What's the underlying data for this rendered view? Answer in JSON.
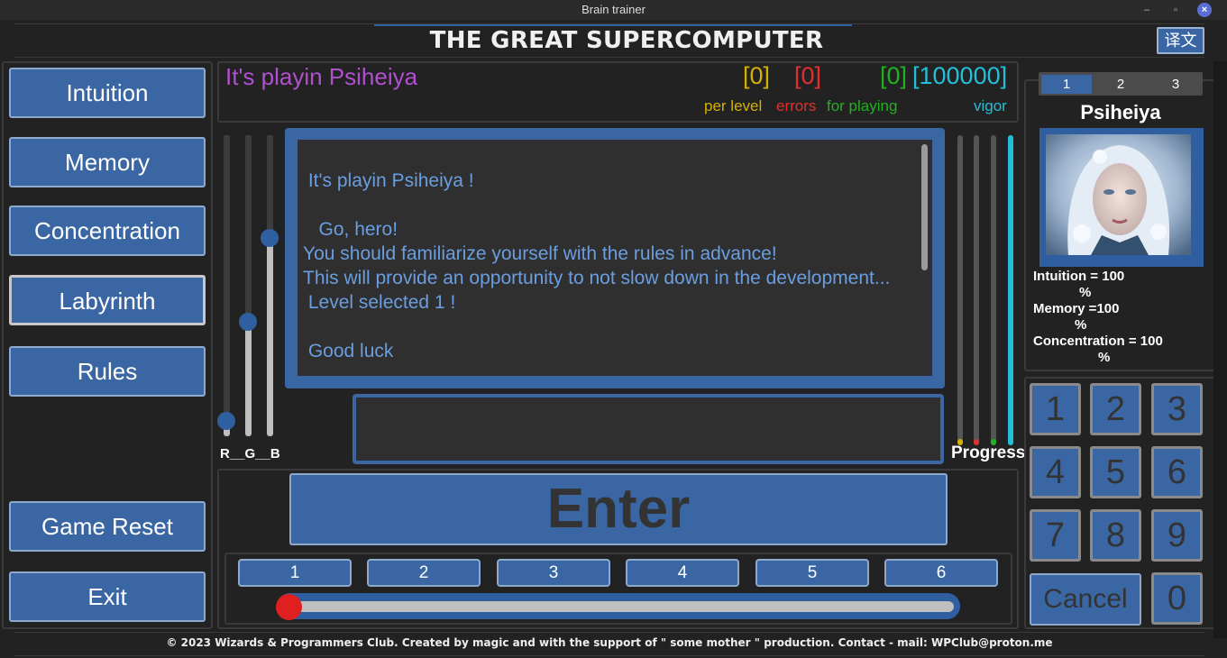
{
  "window": {
    "title": "Brain trainer",
    "min_icon": "minimize-icon",
    "max_icon": "maximize-icon",
    "close_icon": "close-icon"
  },
  "header": {
    "title": "THE GREAT SUPERCOMPUTER",
    "translate_label": "译文"
  },
  "menu": {
    "intuition": "Intuition",
    "memory": "Memory",
    "concentration": "Concentration",
    "labyrinth": "Labyrinth",
    "rules": "Rules",
    "game_reset": "Game Reset",
    "exit": "Exit"
  },
  "info": {
    "playing_title": "It's playin Psiheiya",
    "per_level": {
      "value": "[0]",
      "label": "per level",
      "color": "#d4b000"
    },
    "errors": {
      "value": "[0]",
      "label": "errors",
      "color": "#e03030"
    },
    "for_playing": {
      "value": "[0]",
      "label": "for playing",
      "color": "#22b022"
    },
    "vigor": {
      "value": "[100000]",
      "label": "vigor",
      "color": "#22c0d8"
    }
  },
  "rgb": {
    "label": "R__G__B",
    "r_level": 0.05,
    "g_level": 0.38,
    "b_level": 0.66
  },
  "message": {
    "text": " It's playin Psiheiya !\n\n   Go, hero!\nYou should familiarize yourself with the rules in advance!\nThis will provide an opportunity to not slow down in the development...\n Level selected 1 !\n\n Good luck"
  },
  "answer_input": {
    "value": ""
  },
  "progress": {
    "label": "Progress",
    "bars": [
      {
        "name": "per-level-bar",
        "color": "#d4b000",
        "level": 0.02
      },
      {
        "name": "errors-bar",
        "color": "#e03030",
        "level": 0.02
      },
      {
        "name": "for-playing-bar",
        "color": "#22b022",
        "level": 0.02
      },
      {
        "name": "vigor-bar",
        "color": "#22c0d8",
        "level": 1.0
      }
    ]
  },
  "enter_label": "Enter",
  "levels": {
    "buttons": [
      "1",
      "2",
      "3",
      "4",
      "5",
      "6"
    ],
    "selected": 1
  },
  "character": {
    "tabs": [
      "1",
      "2",
      "3"
    ],
    "selected_tab": 0,
    "name": "Psiheiya",
    "portrait_icon": "character-portrait",
    "stats": [
      {
        "line": "Intuition = 100",
        "pct": "%"
      },
      {
        "line": "Memory =100",
        "pct": "%"
      },
      {
        "line": "Concentration = 100",
        "pct": "%"
      }
    ]
  },
  "keypad": {
    "keys": [
      "1",
      "2",
      "3",
      "4",
      "5",
      "6",
      "7",
      "8",
      "9"
    ],
    "zero": "0",
    "cancel": "Cancel"
  },
  "footer": "© 2023 Wizards & Programmers Club. Created by magic and with the support of \" some mother \" production. Contact - mail: WPClub@proton.me"
}
